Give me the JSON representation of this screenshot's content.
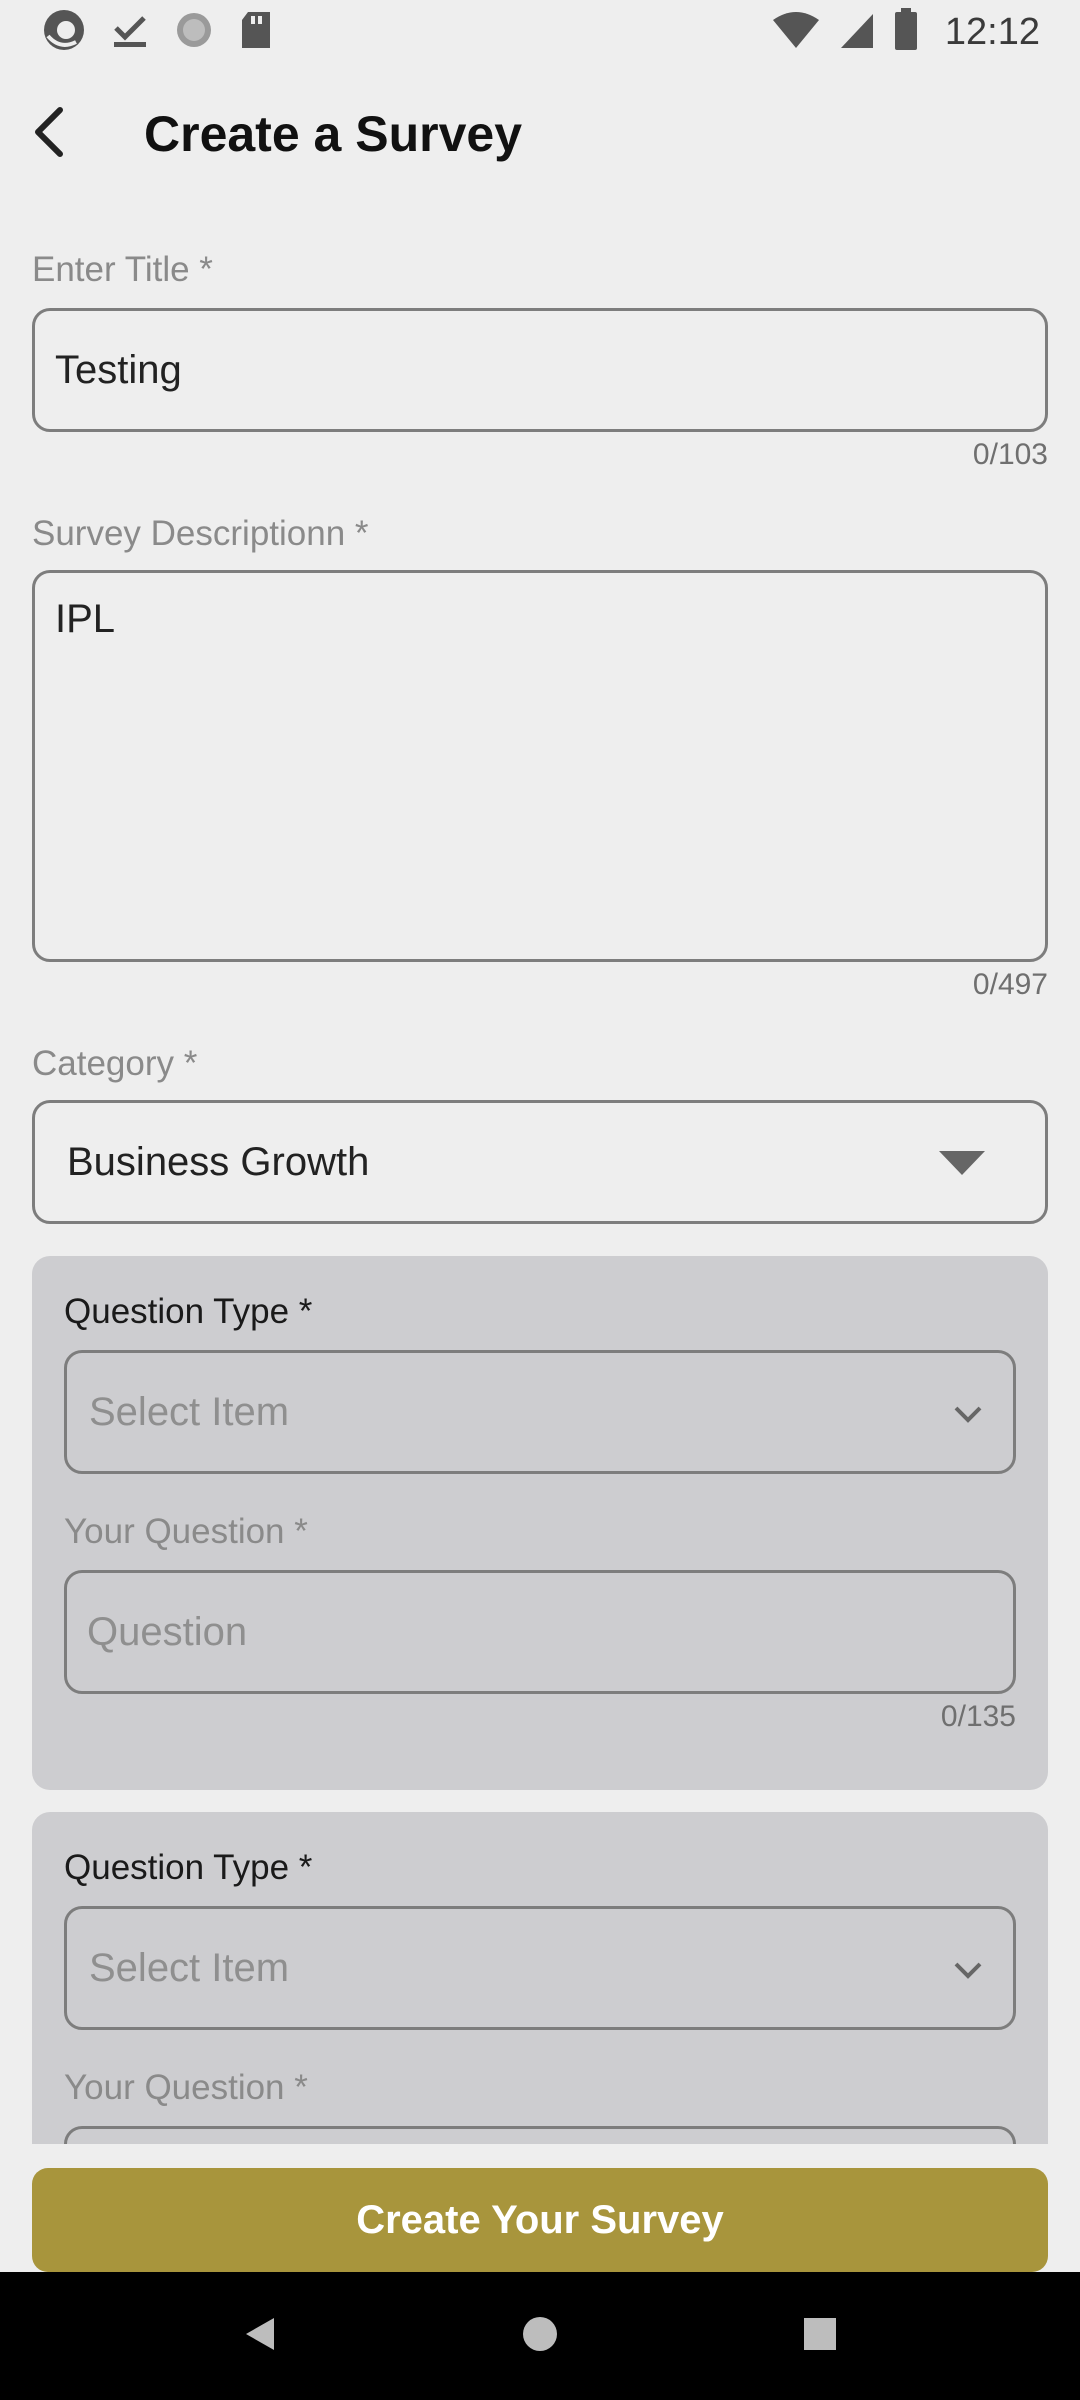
{
  "status_bar": {
    "time": "12:12",
    "left_icons": [
      "app-logo-icon",
      "download-done-icon",
      "sync-icon",
      "sd-card-icon"
    ],
    "right_icons": [
      "wifi-icon",
      "signal-icon",
      "battery-icon"
    ]
  },
  "header": {
    "title": "Create a Survey"
  },
  "form": {
    "title_label": "Enter Title *",
    "title_value": "Testing",
    "title_counter": "0/103",
    "description_label": "Survey Descriptionn *",
    "description_value": "IPL",
    "description_counter": "0/497",
    "category_label": "Category *",
    "category_value": "Business Growth"
  },
  "questions": [
    {
      "type_label": "Question Type *",
      "type_placeholder": "Select Item",
      "question_label": "Your Question *",
      "question_placeholder": "Question",
      "question_counter": "0/135"
    },
    {
      "type_label": "Question Type *",
      "type_placeholder": "Select Item",
      "question_label": "Your Question *"
    }
  ],
  "footer": {
    "submit_label": "Create Your Survey"
  },
  "colors": {
    "background": "#eeeeee",
    "card": "#cdcdd0",
    "accent_button": "#a8953c",
    "nav_bar": "#000000"
  }
}
